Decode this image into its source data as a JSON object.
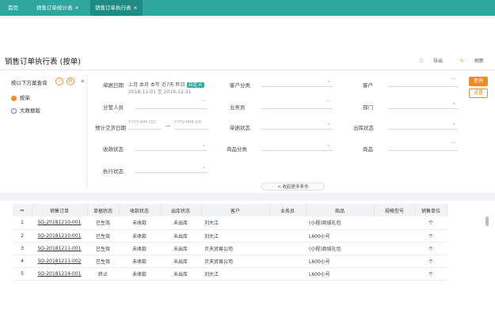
{
  "tabs": [
    {
      "label": "首页",
      "closable": false,
      "active": false
    },
    {
      "label": "销售订单统计表",
      "closable": true,
      "active": false
    },
    {
      "label": "销售订单执行表",
      "closable": true,
      "active": true
    }
  ],
  "page_title": "销售订单执行表 (按单)",
  "actions": {
    "export": "导出",
    "refresh": "刷新"
  },
  "left": {
    "title": "按以下方案查询",
    "icon_info": "!",
    "icon_gear": "⚙",
    "collapse": "«",
    "items": [
      {
        "label": "按单",
        "color": "#f08a24"
      },
      {
        "label": "大数据版",
        "color": "#7a6fd6"
      }
    ]
  },
  "filters": {
    "order_date_label": "单据日期",
    "quick": [
      "上月",
      "本月",
      "本年",
      "近7天",
      "昨日"
    ],
    "quick_active": "自定义",
    "date_range_text": "2018-11-01 至 2018-12-31",
    "customer_class": "客户分类",
    "customer": "客户",
    "branch": "分管人员",
    "salesman": "业务员",
    "dept": "部门",
    "delivery_date": "预计交货日期",
    "date_ph_from": "YYYY-MM-DD",
    "date_ph_to": "YYYY-MM-DD",
    "doc_status": "单据状态",
    "outbound_status": "出库状态",
    "receipt_status": "收款状态",
    "product_class": "商品分类",
    "product": "商品",
    "exec_status": "执行状态",
    "query_btn": "查询",
    "reset_btn": "设置",
    "collapse_link": "≈ 收起更多条件"
  },
  "table": {
    "headers": [
      "⇔",
      "销售订单",
      "单据状态",
      "收款状态",
      "出库状态",
      "客户",
      "业务员",
      "商品",
      "规格型号",
      "销售单位"
    ],
    "rows": [
      [
        "1",
        "SO-20181210-001",
        "已生效",
        "未收款",
        "未出库",
        "刘大江",
        "",
        "(小程)商城礼包",
        "",
        "个"
      ],
      [
        "2",
        "SO-20181210-001",
        "已生效",
        "未收款",
        "未出库",
        "刘大江",
        "",
        "L600小号",
        "",
        "个"
      ],
      [
        "3",
        "SO-20181211-001",
        "已生效",
        "未收款",
        "未出库",
        "贝天贸易公司",
        "",
        "(小程)商城礼包",
        "",
        "个"
      ],
      [
        "4",
        "SO-20181211-002",
        "已生效",
        "未收款",
        "未出库",
        "贝天贸易公司",
        "",
        "L600小号",
        "",
        "个"
      ],
      [
        "5",
        "SO-20181214-001",
        "终止",
        "未收款",
        "未出库",
        "刘大江",
        "",
        "L600小号",
        "",
        "个"
      ]
    ]
  },
  "colors": {
    "teal": "#2fa79e",
    "orange": "#f08a24"
  }
}
